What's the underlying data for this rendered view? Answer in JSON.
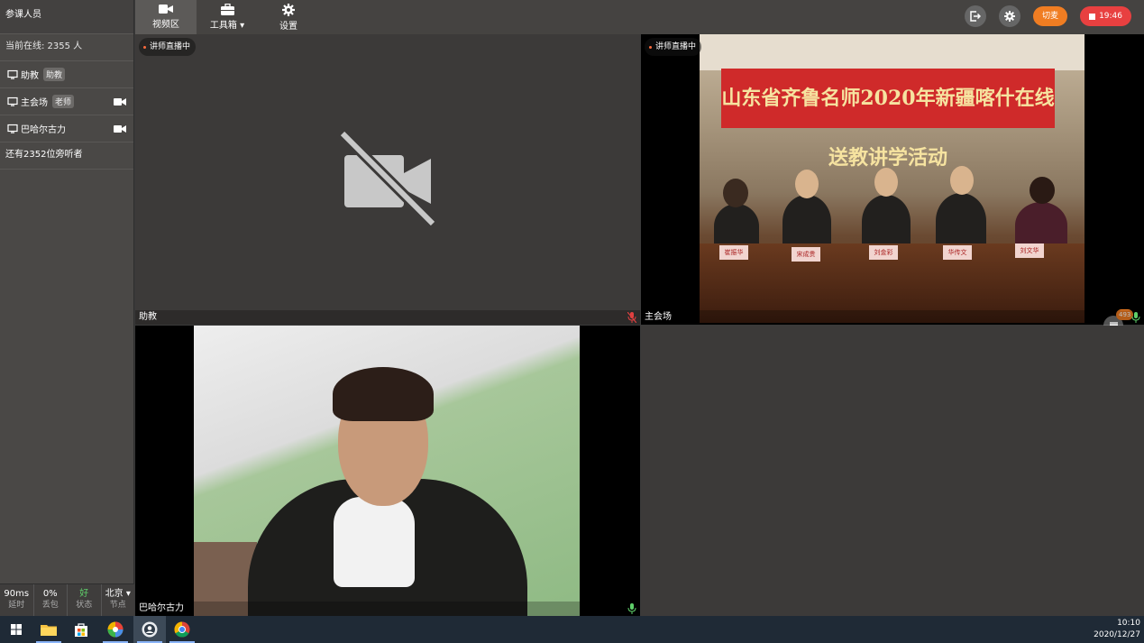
{
  "sidebar": {
    "title": "参课人员",
    "online": "当前在线: 2355 人",
    "members": [
      {
        "name": "助教",
        "tag": "助教",
        "camera": false
      },
      {
        "name": "主会场",
        "tag": "老师",
        "camera": true
      },
      {
        "name": "巴哈尔古力",
        "tag": "",
        "camera": true
      }
    ],
    "listeners": "还有2352位旁听者",
    "stats": [
      {
        "value": "90ms",
        "label": "延时"
      },
      {
        "value": "0%",
        "label": "丢包"
      },
      {
        "value": "好",
        "label": "状态"
      },
      {
        "value": "北京 ▾",
        "label": "节点"
      }
    ]
  },
  "toolbar": {
    "video_label": "视频区",
    "tools_label": "工具箱 ▾",
    "settings_label": "设置",
    "switch_label": "切麦",
    "record_time": "19:46"
  },
  "tiles": {
    "assistant": {
      "badge": "讲师直播中",
      "caption": "助教"
    },
    "main_hall": {
      "badge": "讲师直播中",
      "caption": "主会场",
      "banner": "山东省齐鲁名师2020年新疆喀什在线送教讲学活动",
      "nameplates": [
        "崔振华",
        "宋成贵",
        "刘金彩",
        "华传文",
        "刘文华"
      ],
      "chat_count": "493"
    },
    "student": {
      "caption": "巴哈尔古力"
    }
  },
  "taskbar": {
    "time": "10:10",
    "date": "2020/12/27"
  }
}
